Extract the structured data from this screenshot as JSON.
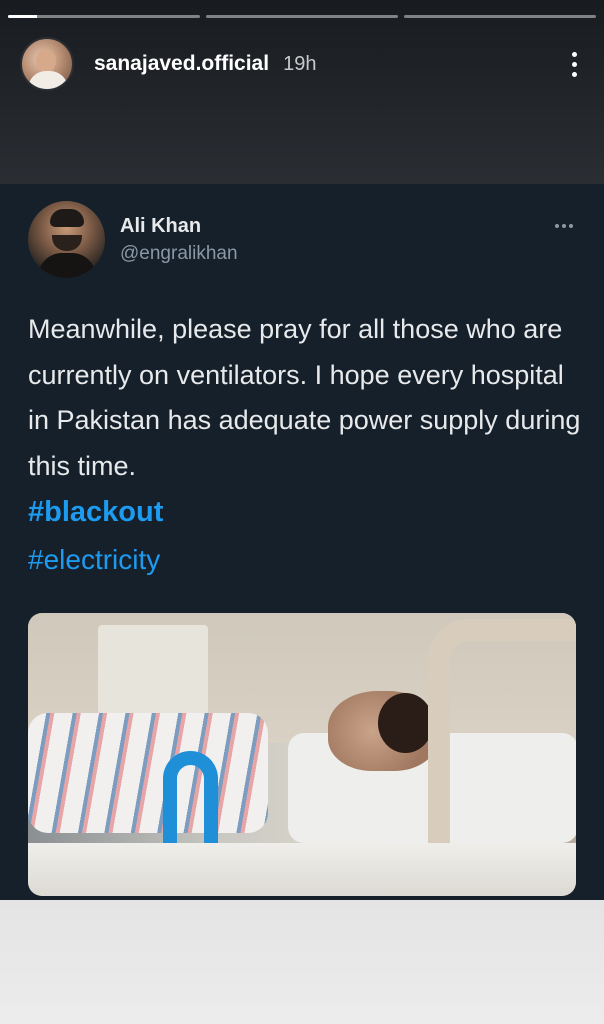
{
  "story": {
    "username": "sanajaved.official",
    "time": "19h",
    "progress": [
      0.15,
      0,
      0
    ]
  },
  "tweet": {
    "name": "Ali Khan",
    "handle": "@engralikhan",
    "text": "Meanwhile, please pray for all those who are currently on ventilators. I hope every hospital in Pakistan has adequate power supply during this time.",
    "hashtags": [
      "#blackout",
      "#electricity"
    ]
  },
  "icons": {
    "story_more": "kebab-menu-icon",
    "tweet_more": "more-horizontal-icon"
  },
  "colors": {
    "tweet_bg": "#15202b",
    "hashtag": "#1d9bf0",
    "secondary_text": "#8b98a5"
  }
}
